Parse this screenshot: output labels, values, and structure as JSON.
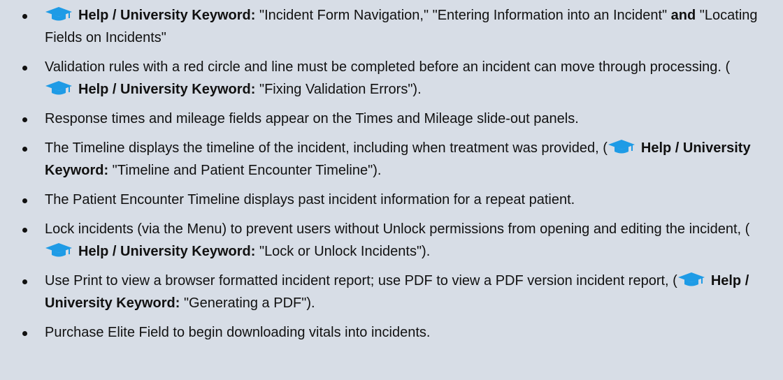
{
  "colors": {
    "background": "#d7dde6",
    "text": "#111111",
    "cap_icon": "#1e9be6"
  },
  "icon": "graduation-cap-icon",
  "keyword_label": "Help / University Keyword:",
  "items": [
    {
      "keyword_label": "Help / University Keyword:",
      "text_a": " \"Incident Form Navigation,\" \"Entering Information into an Incident\" ",
      "and_word": "and",
      "text_b": " \"Locating Fields on Incidents\""
    },
    {
      "before": "Validation rules with a red circle and line must be completed before an incident can move through processing. (",
      "keyword_label": "Help / University Keyword:",
      "after": " \"Fixing Validation Errors\")."
    },
    {
      "text": "Response times and mileage fields appear on the Times and Mileage slide-out panels."
    },
    {
      "before": "The Timeline displays the timeline of the incident, including when treatment was provided, (",
      "keyword_label": "Help / University Keyword:",
      "after": " \"Timeline and Patient Encounter Timeline\")."
    },
    {
      "text": "The Patient Encounter Timeline displays past incident information for a repeat patient."
    },
    {
      "before": "Lock incidents (via the Menu) to prevent users without Unlock permissions from opening and editing the incident, (",
      "keyword_label": "Help / University Keyword:",
      "after": "  \"Lock or Unlock Incidents\")."
    },
    {
      "before": "Use Print to view a browser formatted incident report; use PDF to view a PDF version incident report, (",
      "keyword_label": "Help / University Keyword:",
      "after": "  \"Generating a PDF\")."
    },
    {
      "text": "Purchase Elite Field to begin downloading vitals into incidents."
    }
  ]
}
